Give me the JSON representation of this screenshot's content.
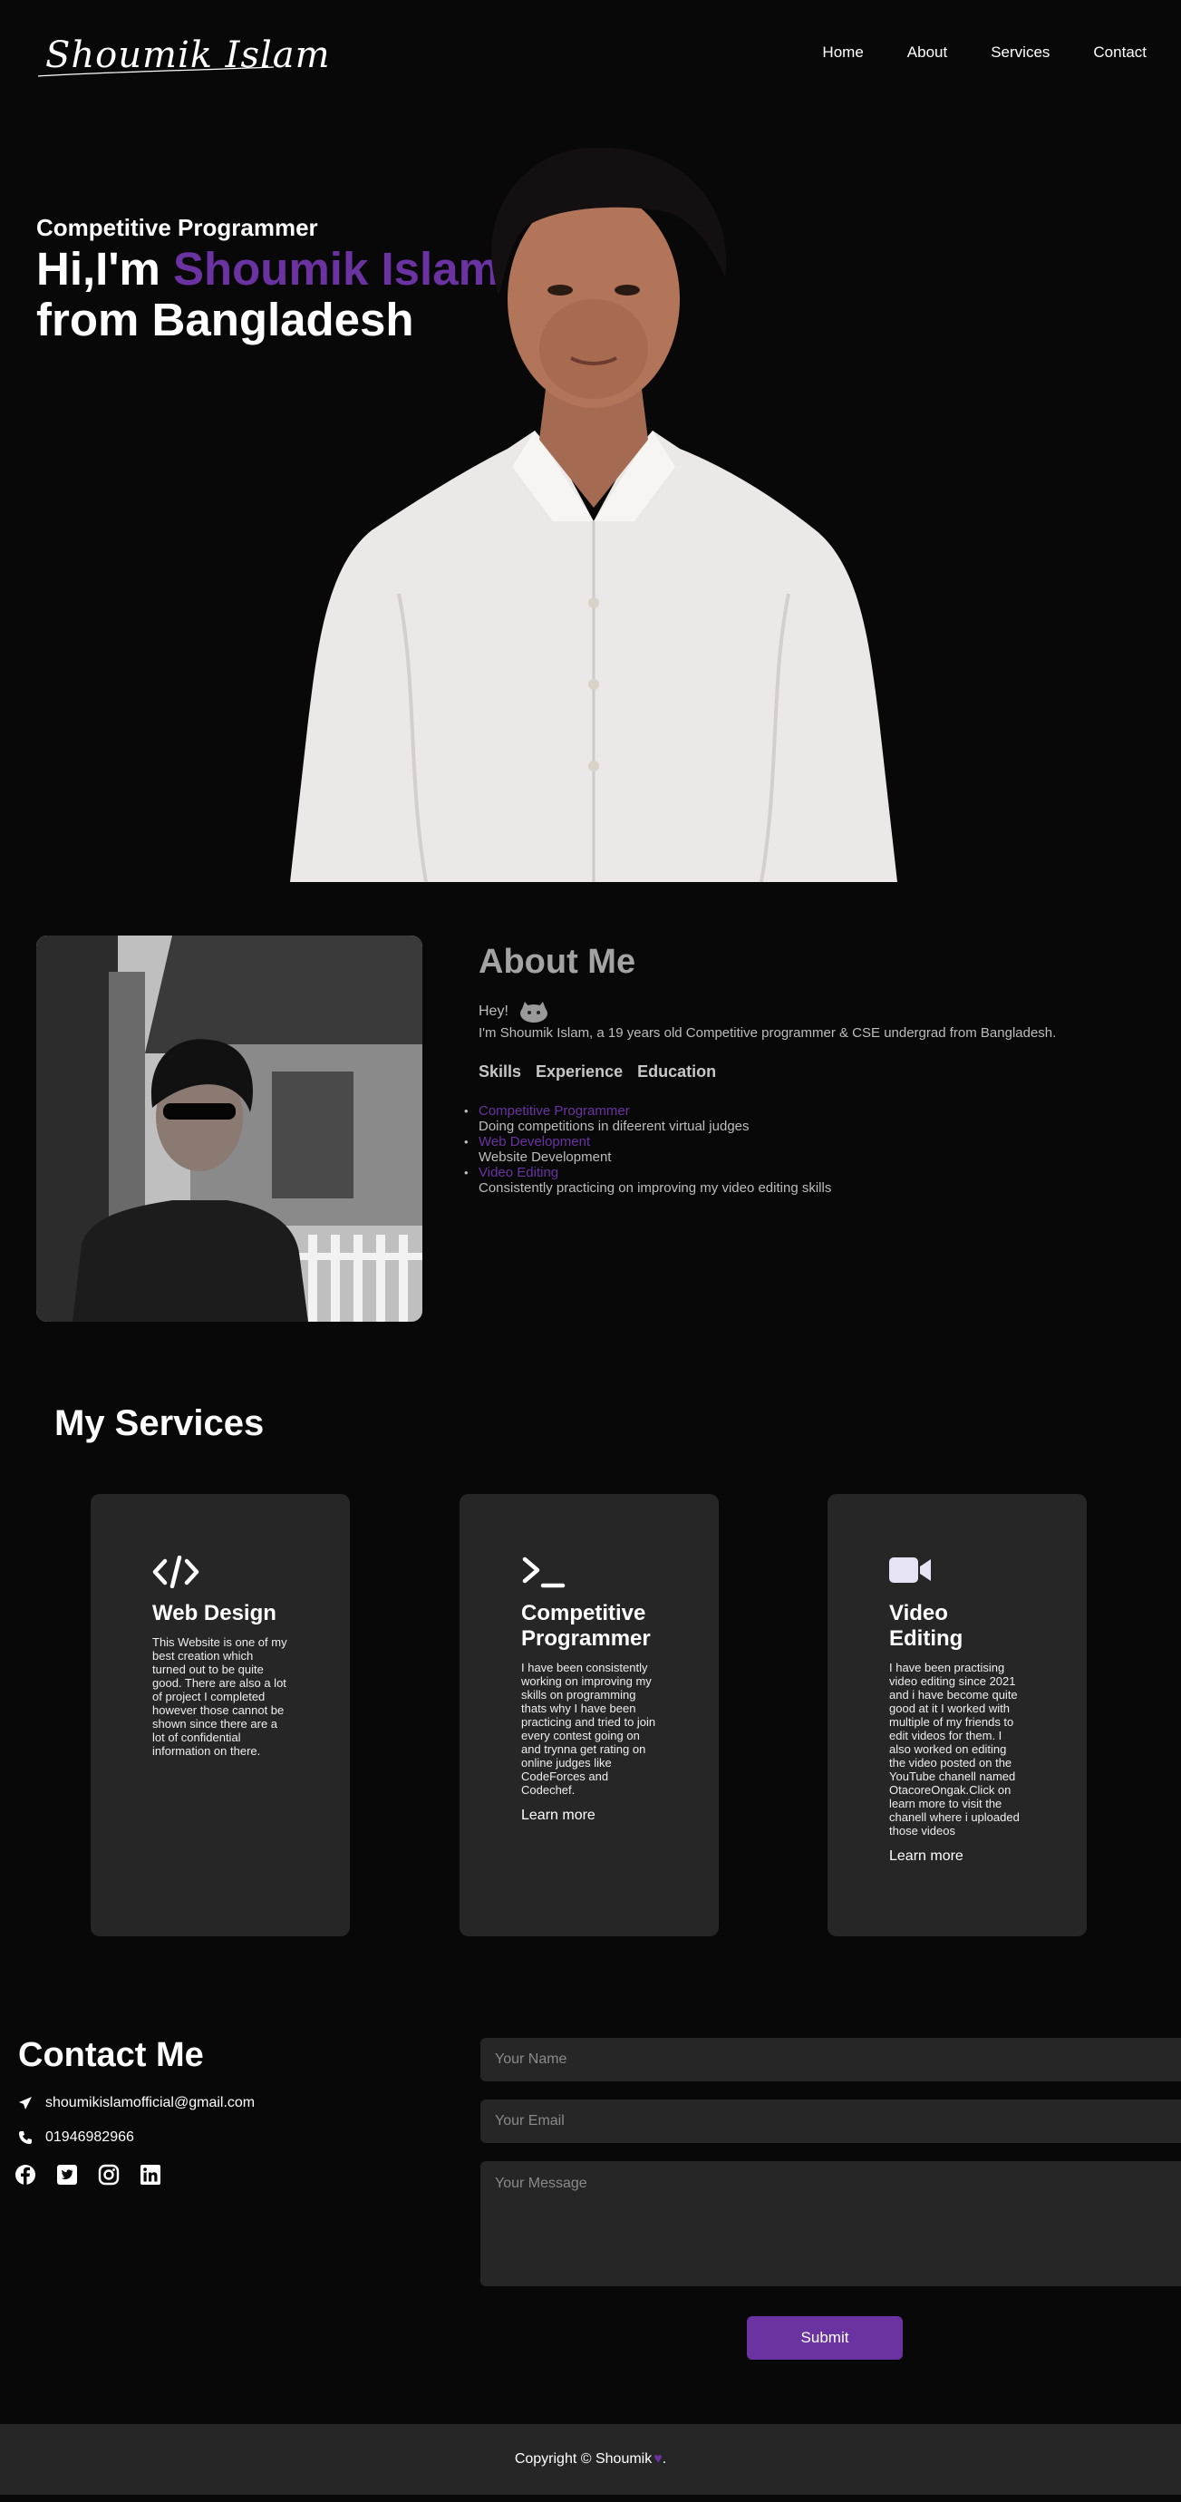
{
  "nav": {
    "logo": "Shoumik Islam",
    "links": [
      "Home",
      "About",
      "Services",
      "Contact"
    ]
  },
  "hero": {
    "subtitle": "Competitive Programmer",
    "line1": "Hi,I'm ",
    "name": "Shoumik Islam",
    "line2": "from Bangladesh"
  },
  "about": {
    "title": "About Me",
    "hey": "Hey!",
    "intro": "I'm Shoumik Islam, a 19 years old Competitive programmer & CSE undergrad from Bangladesh.",
    "tabs": [
      "Skills",
      "Experience",
      "Education"
    ],
    "skills": [
      {
        "title": "Competitive Programmer",
        "desc": "Doing competitions in difeerent virtual judges"
      },
      {
        "title": "Web Development",
        "desc": "Website Development"
      },
      {
        "title": "Video Editing",
        "desc": "Consistently practicing on improving my video editing skills"
      }
    ]
  },
  "services": {
    "title": "My Services",
    "cards": [
      {
        "icon": "code-icon",
        "title": "Web Design",
        "text": "This Website is one of my best creation which turned out to be quite good. There are also a lot of project I completed however those cannot be shown since there are a lot of confidential information on there.",
        "link": ""
      },
      {
        "icon": "terminal-icon",
        "title": "Competitive Programmer",
        "text": "I have been consistently working on improving my skills on programming thats why I have been practicing and tried to join every contest going on and trynna get rating on online judges like CodeForces and Codechef.",
        "link": "Learn more"
      },
      {
        "icon": "video-icon",
        "title": "Video Editing",
        "text": "I have been practising video editing since 2021 and i have become quite good at it I worked with multiple of my friends to edit videos for them. I also worked on editing the video posted on the YouTube chanell named OtacoreOngak.Click on learn more to visit the chanell where i uploaded those videos",
        "link": "Learn more"
      }
    ]
  },
  "contact": {
    "title": "Contact Me",
    "email": "shoumikislamofficial@gmail.com",
    "phone": "01946982966",
    "socials": [
      "facebook-icon",
      "twitter-icon",
      "instagram-icon",
      "linkedin-icon"
    ],
    "form": {
      "name_placeholder": "Your Name",
      "email_placeholder": "Your Email",
      "message_placeholder": "Your Message",
      "submit": "Submit"
    }
  },
  "footer": {
    "text": "Copyright © Shoumik",
    "end": "."
  },
  "colors": {
    "accent": "#6a33a1",
    "background": "#080808",
    "card": "#262626"
  }
}
